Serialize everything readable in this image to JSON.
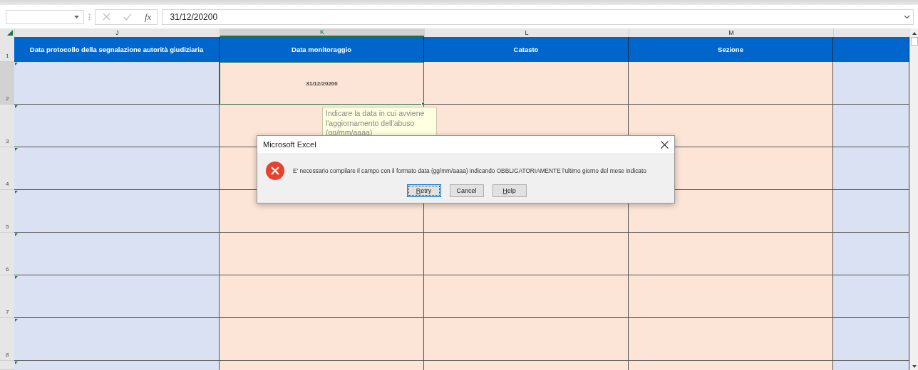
{
  "formula_bar": {
    "function_label": "fx",
    "value": "31/12/20200"
  },
  "columns": [
    {
      "letter": "J",
      "selected": false,
      "color": "#d9e1f2",
      "heading": "Data protocollo della segnalazione autorità giudiziaria"
    },
    {
      "letter": "K",
      "selected": true,
      "color": "#fce4d6",
      "heading": "Data monitoraggio"
    },
    {
      "letter": "L",
      "selected": false,
      "color": "#fce4d6",
      "heading": "Catasto"
    },
    {
      "letter": "M",
      "selected": false,
      "color": "#fce4d6",
      "heading": "Sezione"
    },
    {
      "selected": false,
      "color": "#d9e1f2"
    }
  ],
  "header_row": {
    "number": "1"
  },
  "rows": [
    {
      "number": "2",
      "selected": true,
      "cells": [
        null,
        "31/12/20200",
        null,
        null,
        null
      ]
    },
    {
      "number": "3",
      "selected": false
    },
    {
      "number": "4",
      "selected": false
    },
    {
      "number": "5",
      "selected": false
    },
    {
      "number": "6",
      "selected": false
    },
    {
      "number": "7",
      "selected": false
    },
    {
      "number": "8",
      "selected": false
    },
    {
      "selected": false
    }
  ],
  "tooltip": {
    "text": "Indicare la data in cui avviene l'aggiornamento dell'abuso (gg/mm/aaaa)"
  },
  "dialog": {
    "title": "Microsoft Excel",
    "message": "E' necessario compilare il campo con il formato data (gg/mm/aaaa) indicando OBBLIGATORIAMENTE l'ultimo giorno del mese indicato",
    "buttons": [
      {
        "access_key": "R",
        "label_rest": "etry",
        "default": true
      },
      {
        "label_rest": "Cancel",
        "default": false
      },
      {
        "access_key": "H",
        "label_rest": "elp",
        "default": false
      }
    ]
  }
}
